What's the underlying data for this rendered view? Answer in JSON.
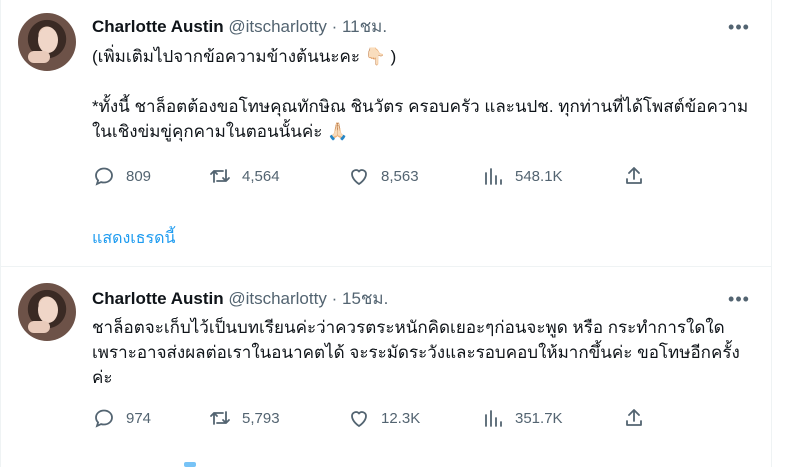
{
  "tweets": [
    {
      "author_name": "Charlotte Austin",
      "author_handle": "@itscharlotty",
      "separator": "·",
      "time": "11ชม.",
      "paragraphs": [
        "(เพิ่มเติมไปจากข้อความข้างต้นนะคะ 👇🏻 )",
        "*ทั้งนี้ ชาล็อตต้องขอโทษคุณทักษิณ ชินวัตร ครอบครัว และนปช. ทุกท่านที่ได้โพสต์ข้อความในเชิงข่มขู่คุกคามในตอนนั้นค่ะ 🙏🏻"
      ],
      "stats": {
        "replies": "809",
        "retweets": "4,564",
        "likes": "8,563",
        "views": "548.1K"
      },
      "thread_link": "แสดงเธรดนี้"
    },
    {
      "author_name": "Charlotte Austin",
      "author_handle": "@itscharlotty",
      "separator": "·",
      "time": "15ชม.",
      "paragraphs": [
        "ชาล็อตจะเก็บไว้เป็นบทเรียนค่ะว่าควรตระหนักคิดเยอะๆก่อนจะพูด หรือ กระทำการใดใด เพราะอาจส่งผลต่อเราในอนาคตได้ จะระมัดระวังและรอบคอบให้มากขึ้นค่ะ ขอโทษอีกครั้งค่ะ"
      ],
      "stats": {
        "replies": "974",
        "retweets": "5,793",
        "likes": "12.3K",
        "views": "351.7K"
      }
    }
  ],
  "icons": {
    "more": "more-dots-icon",
    "reply": "reply-icon",
    "retweet": "retweet-icon",
    "like": "heart-icon",
    "views": "views-icon",
    "share": "share-icon"
  },
  "colors": {
    "link": "#1d9bf0",
    "secondary_text": "#536471",
    "primary_text": "#0f1419"
  }
}
